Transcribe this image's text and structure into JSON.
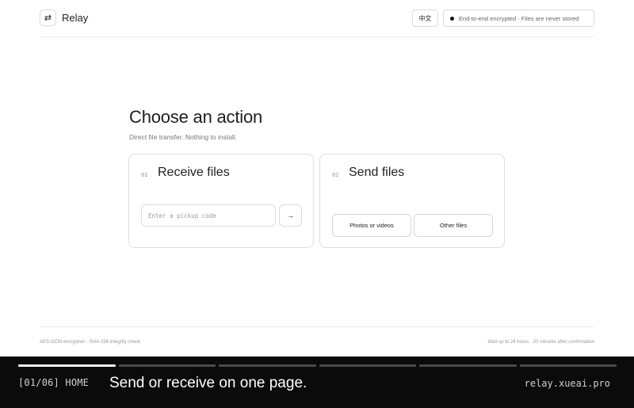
{
  "header": {
    "logo_icon": "swap-arrows-icon",
    "logo_glyph": "⇄",
    "app_name": "Relay",
    "language_button": "中文",
    "status_text": "End-to-end encrypted · Files are never stored"
  },
  "main": {
    "title": "Choose an action",
    "subtitle": "Direct file transfer. Nothing to install.",
    "receive_card": {
      "number": "01",
      "title": "Receive files",
      "code_placeholder": "Enter a pickup code",
      "code_value": "",
      "submit_glyph": "→"
    },
    "send_card": {
      "number": "02",
      "title": "Send files",
      "photos_button": "Photos or videos",
      "other_button": "Other files"
    }
  },
  "footer": {
    "left_text": "AES-GCM encryption · SHA-256 integrity check",
    "right_text": "Wait up to 24 hours · 20 minutes after confirmation"
  },
  "caption": {
    "step": "[01/06] HOME",
    "text": "Send or receive on one page.",
    "domain": "relay.xueai.pro",
    "progress": {
      "current": 1,
      "total": 6
    }
  },
  "colors": {
    "caption_background": "#0b0b0b",
    "accent": "#111111",
    "border": "#dedede"
  }
}
